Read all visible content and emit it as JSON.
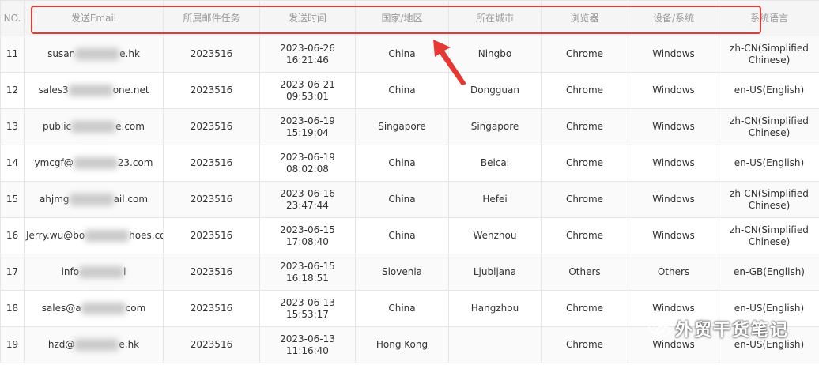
{
  "table": {
    "headers": [
      "NO.",
      "发送Email",
      "所属邮件任务",
      "发送时间",
      "国家/地区",
      "所在城市",
      "浏览器",
      "设备/系统",
      "系统语言"
    ],
    "rows": [
      {
        "no": "11",
        "email_start": "susan",
        "email_end": "e.hk",
        "task": "2023516",
        "date": "2023-06-26",
        "time": "16:21:46",
        "country": "China",
        "city": "Ningbo",
        "browser": "Chrome",
        "device": "Windows",
        "language": "zh-CN(Simplified Chinese)"
      },
      {
        "no": "12",
        "email_start": "sales3",
        "email_end": "one.net",
        "task": "2023516",
        "date": "2023-06-21",
        "time": "09:53:01",
        "country": "China",
        "city": "Dongguan",
        "browser": "Chrome",
        "device": "Windows",
        "language": "en-US(English)"
      },
      {
        "no": "13",
        "email_start": "public",
        "email_end": "e.com",
        "task": "2023516",
        "date": "2023-06-19",
        "time": "15:19:04",
        "country": "Singapore",
        "city": "Singapore",
        "browser": "Chrome",
        "device": "Windows",
        "language": "zh-CN(Simplified Chinese)"
      },
      {
        "no": "14",
        "email_start": "ymcgf@",
        "email_end": "23.com",
        "task": "2023516",
        "date": "2023-06-19",
        "time": "08:02:08",
        "country": "China",
        "city": "Beicai",
        "browser": "Chrome",
        "device": "Windows",
        "language": "en-US(English)"
      },
      {
        "no": "15",
        "email_start": "ahjmg",
        "email_end": "ail.com",
        "task": "2023516",
        "date": "2023-06-16",
        "time": "23:47:44",
        "country": "China",
        "city": "Hefei",
        "browser": "Chrome",
        "device": "Windows",
        "language": "zh-CN(Simplified Chinese)"
      },
      {
        "no": "16",
        "email_start": "Jerry.wu@bo",
        "email_end": "hoes.com",
        "task": "2023516",
        "date": "2023-06-15",
        "time": "17:08:40",
        "country": "China",
        "city": "Wenzhou",
        "browser": "Chrome",
        "device": "Windows",
        "language": "zh-CN(Simplified Chinese)"
      },
      {
        "no": "17",
        "email_start": "info",
        "email_end": "i",
        "task": "2023516",
        "date": "2023-06-15",
        "time": "16:18:51",
        "country": "Slovenia",
        "city": "Ljubljana",
        "browser": "Others",
        "device": "Others",
        "language": "en-GB(English)"
      },
      {
        "no": "18",
        "email_start": "sales@a",
        "email_end": "com",
        "task": "2023516",
        "date": "2023-06-13",
        "time": "15:53:17",
        "country": "China",
        "city": "Hangzhou",
        "browser": "Chrome",
        "device": "Windows",
        "language": "en-US(English)"
      },
      {
        "no": "19",
        "email_start": "hzd@",
        "email_end": "e.hk",
        "task": "2023516",
        "date": "2023-06-13",
        "time": "11:16:40",
        "country": "Hong Kong",
        "city": "",
        "browser": "Chrome",
        "device": "Windows",
        "language": "en-US(English)"
      }
    ]
  },
  "watermark": {
    "text": "外贸干货笔记",
    "icon": "wechat-icon"
  },
  "colors": {
    "annotation_red": "#e53935",
    "header_bg": "#f5f5f5",
    "header_text": "#9a9a9a"
  }
}
